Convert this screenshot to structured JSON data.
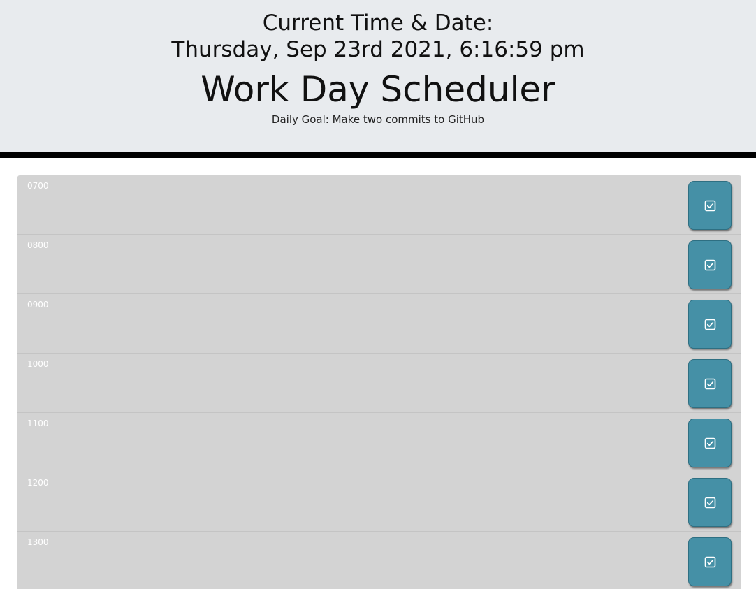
{
  "header": {
    "current_label": "Current Time & Date:",
    "current_datetime": "Thursday, Sep 23rd 2021, 6:16:59 pm",
    "title": "Work Day Scheduler",
    "goal": "Daily Goal: Make two commits to GitHub"
  },
  "schedule": {
    "rows": [
      {
        "hour": "0700",
        "text": ""
      },
      {
        "hour": "0800",
        "text": ""
      },
      {
        "hour": "0900",
        "text": ""
      },
      {
        "hour": "1000",
        "text": ""
      },
      {
        "hour": "1100",
        "text": ""
      },
      {
        "hour": "1200",
        "text": ""
      },
      {
        "hour": "1300",
        "text": ""
      }
    ],
    "save_icon": "check-square-icon"
  },
  "colors": {
    "header_bg": "#e8ebee",
    "row_bg": "#d3d3d3",
    "save_button": "#4590a6",
    "hour_text": "#ffffff"
  }
}
